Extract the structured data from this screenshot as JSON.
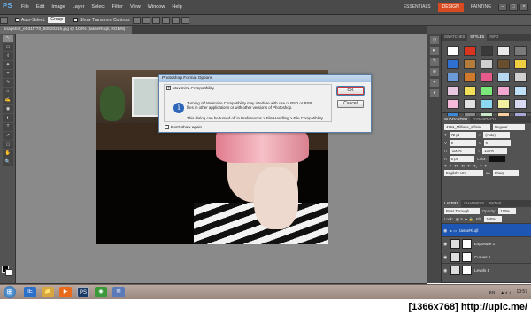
{
  "app": {
    "logo": "PS",
    "menus": [
      "File",
      "Edit",
      "Image",
      "Layer",
      "Select",
      "Filter",
      "View",
      "Window",
      "Help"
    ],
    "workspaces": [
      "ESSENTIALS",
      "DESIGN",
      "PAINTING"
    ],
    "active_workspace": "DESIGN",
    "window_buttons": [
      "–",
      "□",
      "×"
    ]
  },
  "options_bar": {
    "auto_select_label": "Auto-Select:",
    "auto_select_value": "Group",
    "transform_label": "Show Transform Controls"
  },
  "document_tab": {
    "label": "snapshot_e031f770_80520215.jpg @ 100% (tasseRi.qll, RGB/8) *"
  },
  "tools": [
    "↖",
    "▭",
    "ℓ",
    "✦",
    "⌗",
    "✎",
    "⌂",
    "✍",
    "◉",
    "◐",
    "T",
    "↗",
    "▢",
    "✋",
    "🔍"
  ],
  "dialog": {
    "title": "Photoshop Format Options",
    "maximize_label": "Maximize Compatibility",
    "maximize_checked": true,
    "message": "Turning off Maximize Compatibility may interfere with use of PSD or PSB files in other applications or with other versions of Photoshop.",
    "message2": "This dialog can be turned off in Preferences > File Handling > File Compatibility.",
    "dont_show_label": "Don't show again",
    "ok_label": "OK",
    "cancel_label": "Cancel",
    "info_icon": "i"
  },
  "panels": {
    "swatch_tabs": [
      "SWATCHES",
      "STYLES",
      "INFO"
    ],
    "active_swatch_tab": "STYLES",
    "styles": [
      "#ffffff",
      "#d8341f",
      "#3a3a3a",
      "#e9e9e9",
      "#7a7a7a",
      "#2f6fd1",
      "#b37c3a",
      "#cfcfcf",
      "#6a4f2f",
      "#f0d040",
      "#6a9ad8",
      "#cf7a2a",
      "#e85a8c",
      "#b5d7f0",
      "#d0d0d0",
      "#e8c8e0",
      "#f2e05a",
      "#7ae87a",
      "#f0a8d0",
      "#c0e0f8",
      "#f4b8d8",
      "#e0e0e0",
      "#8cd8f0",
      "#f0f0a0",
      "#d8d8f0",
      "#3a8ad8",
      "#888888",
      "#c8e8c8",
      "#f8d0a0",
      "#a8a8d8"
    ],
    "char_tabs": [
      "CHARACTER",
      "PARAGRAPH"
    ],
    "font_family": "4751_Millione_Oficial",
    "font_style": "Regular",
    "font_size": "72 pt",
    "leading": "(Auto)",
    "kerning": "0",
    "tracking": "0",
    "vertical_scale": "100%",
    "horizontal_scale": "100%",
    "baseline": "0 pt",
    "color_label": "Color:",
    "language": "English: UK",
    "aa": "Sharp",
    "layer_tabs": [
      "LAYERS",
      "CHANNELS",
      "PATHS"
    ],
    "blend_mode": "Pass Through",
    "opacity_label": "Opacity:",
    "opacity": "100%",
    "lock_label": "Lock:",
    "fill_label": "Fill:",
    "fill": "100%",
    "layers": [
      {
        "name": "tasseRi.qll",
        "selected": true
      },
      {
        "name": "Exposure 1",
        "selected": false
      },
      {
        "name": "Curves 1",
        "selected": false
      },
      {
        "name": "Levels 1",
        "selected": false
      }
    ]
  },
  "status": {
    "zoom": "100%",
    "doc": "Doc: 791.0K/791.0K"
  },
  "taskbar": {
    "start": "⊞",
    "apps": [
      "IE",
      "📁",
      "▶",
      "PS",
      "◉",
      "✉"
    ],
    "lang": "EN",
    "clock": "10:57"
  },
  "watermark": "[1366x768]  http://upic.me/"
}
